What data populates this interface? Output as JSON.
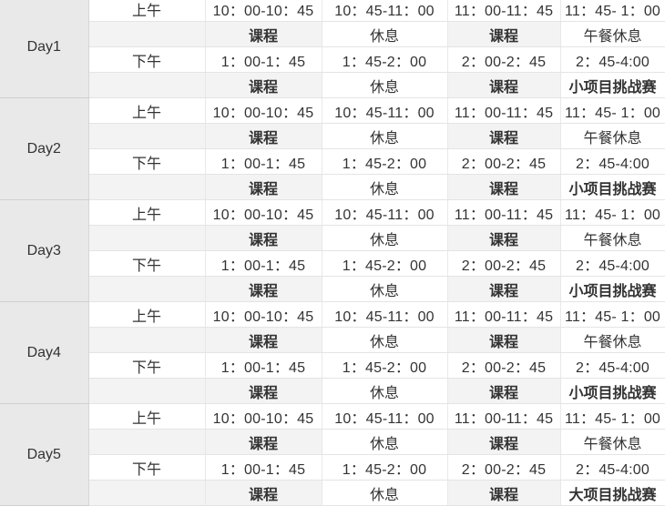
{
  "labels": {
    "am": "上午",
    "pm": "下午",
    "course": "课程",
    "rest": "休息",
    "lunch": "午餐休息",
    "small_challenge": "小项目挑战赛",
    "big_challenge": "大项目挑战赛"
  },
  "am_times": [
    "10：00-10：45",
    "10：45-11：00",
    "11：00-11：45",
    "11：45- 1：00"
  ],
  "pm_times": [
    "1：00-1：45",
    "1：45-2：00",
    "2：00-2：45",
    "2：45-4:00"
  ],
  "days": [
    {
      "name": "Day1",
      "last_activity": "小项目挑战赛"
    },
    {
      "name": "Day2",
      "last_activity": "小项目挑战赛"
    },
    {
      "name": "Day3",
      "last_activity": "小项目挑战赛"
    },
    {
      "name": "Day4",
      "last_activity": "小项目挑战赛"
    },
    {
      "name": "Day5",
      "last_activity": "大项目挑战赛"
    }
  ],
  "colors": {
    "course": "#7030a0",
    "small_challenge": "#ffb100",
    "big_challenge": "#c00000",
    "day_cell_bg": "#e9e9e9",
    "alt_row_bg": "#f3f3f3"
  }
}
